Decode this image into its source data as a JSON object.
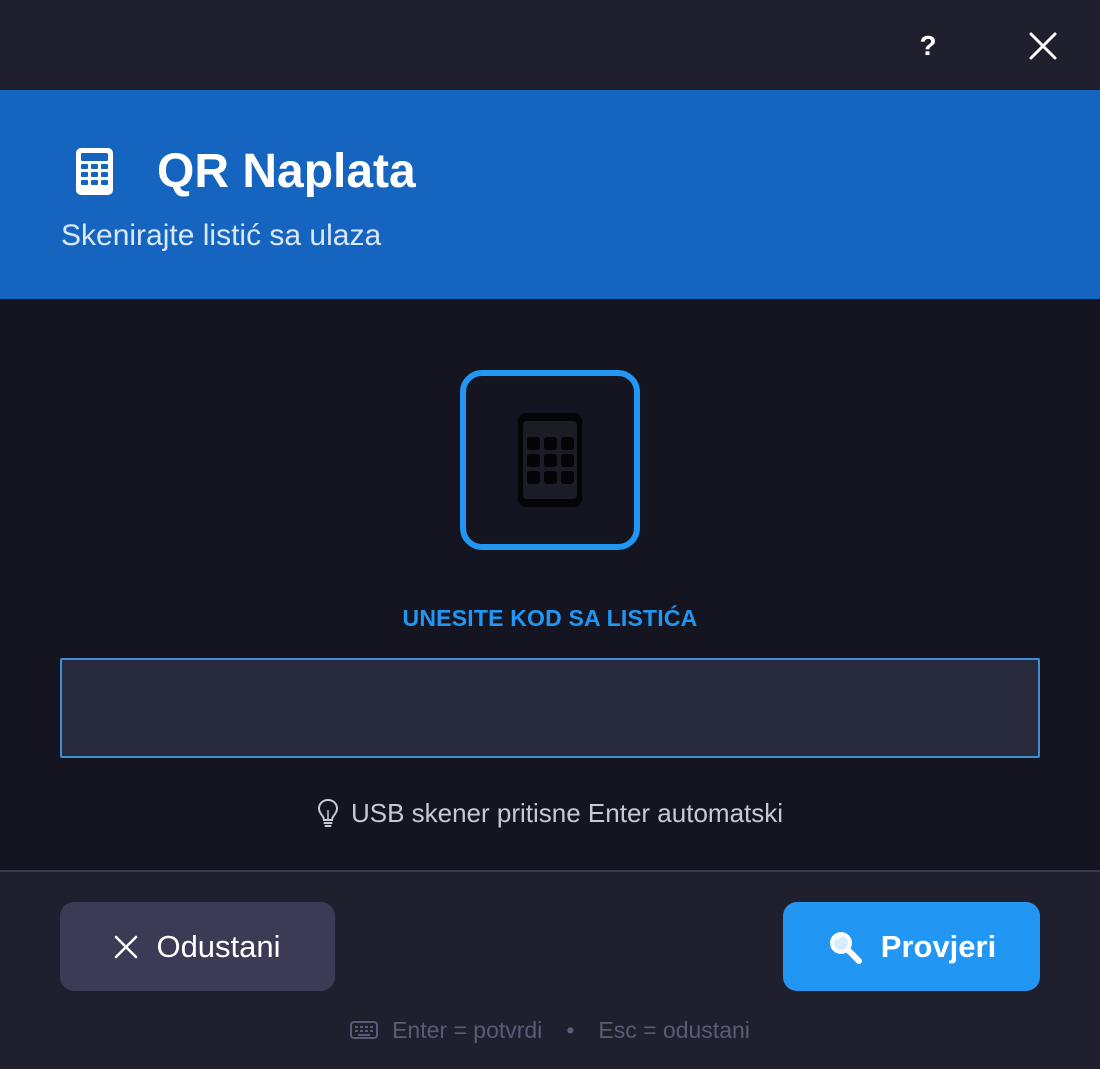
{
  "titlebar": {
    "help_label": "?",
    "help_icon": "question-mark-icon",
    "close_icon": "close-icon"
  },
  "header": {
    "icon": "calculator-icon",
    "title": "QR Naplata",
    "subtitle": "Skenirajte listić sa ulaza"
  },
  "main": {
    "scan_icon": "calculator-keypad-icon",
    "input_label": "UNESITE KOD SA LISTIĆA",
    "input_value": "",
    "hint_icon": "lightbulb-icon",
    "hint": "USB skener pritisne Enter automatski"
  },
  "footer": {
    "cancel_label": "Odustani",
    "cancel_icon": "close-icon",
    "check_label": "Provjeri",
    "check_icon": "magnifier-icon",
    "shortcut_icon": "keyboard-icon",
    "shortcut_enter": "Enter = potvrdi",
    "shortcut_sep": "•",
    "shortcut_esc": "Esc = odustani"
  },
  "colors": {
    "accent": "#2196f3",
    "header_bg": "#1565c0",
    "background": "#141520",
    "panel": "#1f1f2e",
    "input_bg": "#282a3e",
    "cancel_bg": "#3b3b56"
  }
}
